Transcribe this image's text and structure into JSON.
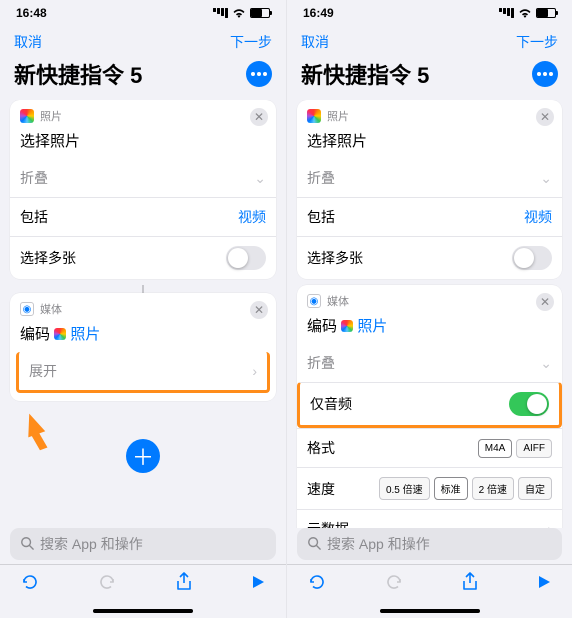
{
  "screens": [
    {
      "status": {
        "time": "16:48"
      },
      "nav": {
        "cancel": "取消",
        "next": "下一步"
      },
      "title": "新快捷指令 5",
      "card_photos": {
        "app_label": "照片",
        "action_title": "选择照片",
        "collapse_label": "折叠",
        "include_label": "包括",
        "include_value": "视频",
        "multi_label": "选择多张"
      },
      "card_media": {
        "app_label": "媒体",
        "action_prefix": "编码",
        "action_link": "照片",
        "expand_label": "展开"
      },
      "search_placeholder": "搜索 App 和操作"
    },
    {
      "status": {
        "time": "16:49"
      },
      "nav": {
        "cancel": "取消",
        "next": "下一步"
      },
      "title": "新快捷指令 5",
      "card_photos": {
        "app_label": "照片",
        "action_title": "选择照片",
        "collapse_label": "折叠",
        "include_label": "包括",
        "include_value": "视频",
        "multi_label": "选择多张"
      },
      "card_media": {
        "app_label": "媒体",
        "action_prefix": "编码",
        "action_link": "照片",
        "collapse_label": "折叠",
        "audio_only_label": "仅音频",
        "format_label": "格式",
        "format_options": [
          "M4A",
          "AIFF"
        ],
        "speed_label": "速度",
        "speed_options": [
          "0.5 倍速",
          "标准",
          "2 倍速",
          "自定"
        ],
        "metadata_label": "元数据"
      },
      "search_placeholder": "搜索 App 和操作"
    }
  ]
}
